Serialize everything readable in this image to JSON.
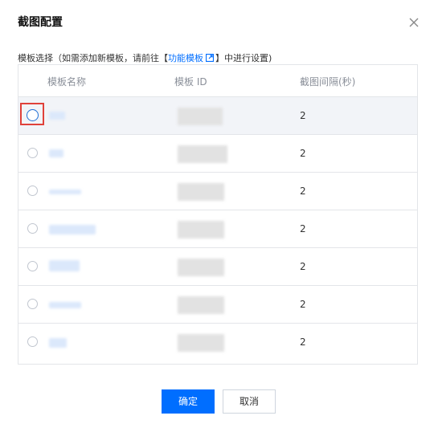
{
  "dialog": {
    "title": "截图配置",
    "hint_prefix": "模板选择（如需添加新模板，请前往【",
    "hint_link": "功能模板",
    "hint_suffix": "】中进行设置)"
  },
  "table": {
    "columns": [
      "模板名称",
      "模板 ID",
      "截图间隔(秒)"
    ],
    "rows": [
      {
        "interval": "2",
        "selected": true
      },
      {
        "interval": "2",
        "selected": false
      },
      {
        "interval": "2",
        "selected": false
      },
      {
        "interval": "2",
        "selected": false
      },
      {
        "interval": "2",
        "selected": false
      },
      {
        "interval": "2",
        "selected": false
      },
      {
        "interval": "2",
        "selected": false
      }
    ]
  },
  "footer": {
    "confirm_label": "确定",
    "cancel_label": "取消"
  },
  "colors": {
    "primary": "#006eff",
    "highlight_box": "#e0413a",
    "selected_row": "#f2f4f8"
  }
}
